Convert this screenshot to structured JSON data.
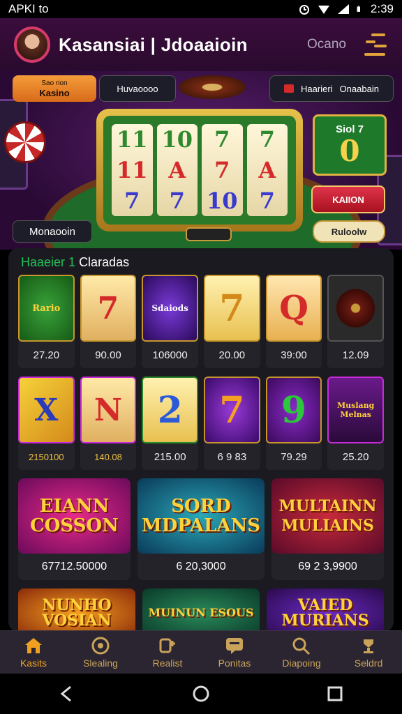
{
  "status_bar": {
    "left_text": "APKI to",
    "time": "2:39"
  },
  "header": {
    "title": "Kasansiai | Jdoaaioin",
    "link": "Ocano"
  },
  "hero": {
    "btn_kasino": "Kasino",
    "btn_kasino_sub": "Sao rion",
    "btn_mid": "Huvaoooo",
    "btn_mid_sub": "",
    "btn_right_1": "Haarieri",
    "btn_right_2": "Onaabain",
    "reels": [
      [
        "11",
        "11",
        "7"
      ],
      [
        "10",
        "A",
        "7"
      ],
      [
        "7",
        "7",
        "10"
      ],
      [
        "7",
        "A",
        "7"
      ]
    ],
    "promo_title": "Siol 7",
    "promo_value": "0",
    "btn_kaion": "KAIION",
    "btn_monaooin": "Monaooin",
    "btn_rulooiw": "Ruloolw"
  },
  "games": {
    "section_green": "Haaeier 1",
    "section_white": "Claradas",
    "row1": [
      {
        "label": "Rario",
        "price": "27.20"
      },
      {
        "label": "7",
        "price": "90.00"
      },
      {
        "label": "Sdaiods",
        "price": "106000"
      },
      {
        "label": "7",
        "price": "20.00"
      },
      {
        "label": "Q",
        "price": "39:00"
      },
      {
        "label": "",
        "price": "12.09"
      }
    ],
    "row2": [
      {
        "label": "X",
        "price": "2150100"
      },
      {
        "label": "N",
        "price": "140.08"
      },
      {
        "label": "2",
        "price": "215.00"
      },
      {
        "label": "7",
        "price": "6 9 83"
      },
      {
        "label": "9",
        "price": "79.29"
      },
      {
        "label": "Muslang Melnas",
        "price": "25.20"
      }
    ],
    "big": [
      {
        "label": "EIANN COSSON",
        "price": "67712.50000"
      },
      {
        "label": "SORD MDPALANS",
        "price": "6 20,3000"
      },
      {
        "label": "MULTAINN MULIAINS",
        "price": "69 2 3,9900"
      }
    ],
    "peek": [
      {
        "label": "NUNHO VOSIAN"
      },
      {
        "label": "MUINUN ESOUS"
      },
      {
        "label": "VAIED MURIANS"
      }
    ]
  },
  "bottom_nav": [
    {
      "label": "Kasits",
      "icon": "home-icon"
    },
    {
      "label": "Slealing",
      "icon": "chip-icon"
    },
    {
      "label": "Realist",
      "icon": "dice-icon"
    },
    {
      "label": "Ponitas",
      "icon": "chat-icon"
    },
    {
      "label": "Diapoing",
      "icon": "search-icon"
    },
    {
      "label": "Seldrd",
      "icon": "trophy-icon"
    }
  ],
  "colors": {
    "accent": "#f0a020",
    "green": "#23c25a",
    "panel": "#1a1a20"
  }
}
